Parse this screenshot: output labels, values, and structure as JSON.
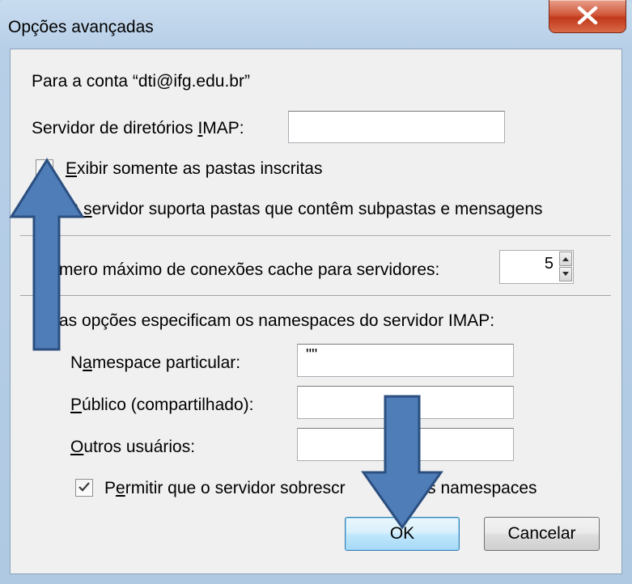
{
  "window": {
    "title": "Opções avançadas"
  },
  "account": {
    "label": "Para a conta “dti@ifg.edu.br”"
  },
  "imap_directory": {
    "label_pre": "Servidor de diretórios ",
    "label_ul": "I",
    "label_post": "MAP:",
    "value": ""
  },
  "subscribed_only": {
    "label_pre": "",
    "label_ul": "E",
    "label_post": "xibir somente as pastas inscritas",
    "checked": false
  },
  "subfolders": {
    "label_pre": "O ",
    "label_ul": "s",
    "label_post": "ervidor suporta pastas que contêm subpastas e mensagens",
    "checked": true
  },
  "max_connections": {
    "label": "mero máximo de conexões cache para servidores:",
    "value": "5"
  },
  "namespaces": {
    "heading": "as opções especificam os namespaces do servidor IMAP:",
    "personal": {
      "label_pre": "N",
      "label_ul": "a",
      "label_post": "mespace particular:",
      "value": "\"\""
    },
    "public": {
      "label_pre": "",
      "label_ul": "P",
      "label_post": "úblico (compartilhado):",
      "value": ""
    },
    "others": {
      "label_pre": "",
      "label_ul": "O",
      "label_post": "utros usuários:",
      "value": ""
    },
    "override": {
      "label_pre": "P",
      "label_ul": "e",
      "label_post": "rmitir que o servidor sobrescr",
      "label_tail": "tes namespaces",
      "checked": true
    }
  },
  "buttons": {
    "ok": "OK",
    "cancel": "Cancelar"
  },
  "colors": {
    "arrow_fill": "#4f7db8",
    "arrow_stroke": "#2b4f80",
    "close_red": "#c0391c"
  }
}
